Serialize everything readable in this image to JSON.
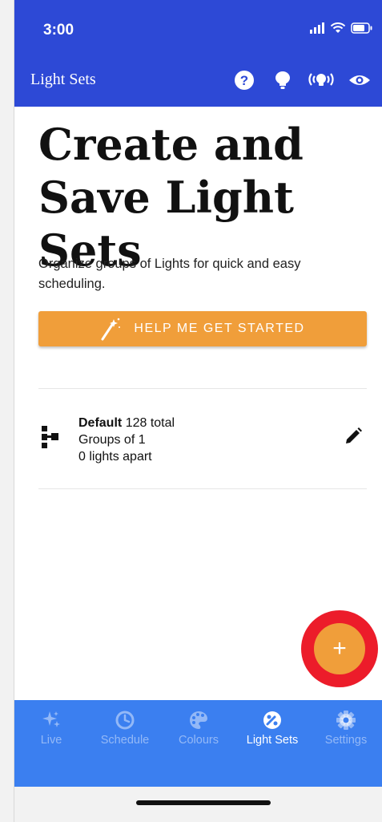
{
  "status_bar": {
    "time": "3:00"
  },
  "app_bar": {
    "title": "Light Sets",
    "actions": [
      {
        "icon": "help-icon"
      },
      {
        "icon": "bulb-icon"
      },
      {
        "icon": "broadcast-bulb-icon"
      },
      {
        "icon": "eye-icon"
      }
    ]
  },
  "main": {
    "heading": "Create and Save Light Sets",
    "subtitle": "Organize groups of Lights for quick and easy scheduling.",
    "help_button": {
      "label": "HELP ME GET STARTED",
      "icon": "magic-wand-icon"
    },
    "light_sets": [
      {
        "name": "Default",
        "total": "128 total",
        "groups": "Groups of 1",
        "apart": "0 lights apart",
        "icon": "light-set-tree-icon",
        "edit_icon": "pencil-icon"
      }
    ]
  },
  "fab": {
    "label": "+"
  },
  "bottom_nav": {
    "items": [
      {
        "label": "Live",
        "icon": "sparkle-icon",
        "active": false
      },
      {
        "label": "Schedule",
        "icon": "schedule-icon",
        "active": false
      },
      {
        "label": "Colours",
        "icon": "palette-icon",
        "active": false
      },
      {
        "label": "Light Sets",
        "icon": "light-sets-icon",
        "active": true
      },
      {
        "label": "Settings",
        "icon": "gear-icon",
        "active": false
      }
    ]
  },
  "colors": {
    "app_bar": "#2d49d6",
    "accent": "#f09e3a",
    "bottom_nav": "#3b7ff0",
    "fab_ring": "#ec1c2a"
  }
}
